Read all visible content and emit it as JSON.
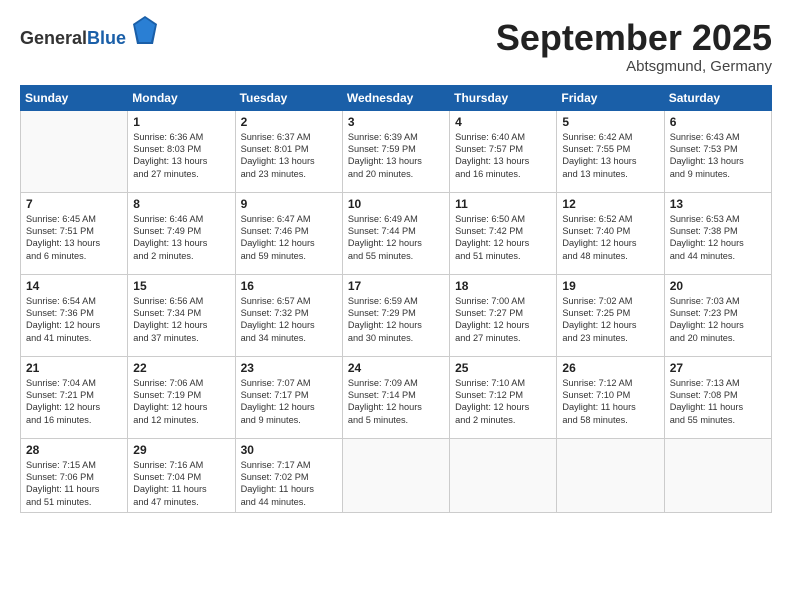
{
  "logo": {
    "general": "General",
    "blue": "Blue"
  },
  "header": {
    "month": "September 2025",
    "location": "Abtsgmund, Germany"
  },
  "weekdays": [
    "Sunday",
    "Monday",
    "Tuesday",
    "Wednesday",
    "Thursday",
    "Friday",
    "Saturday"
  ],
  "weeks": [
    [
      {
        "day": null,
        "data": null
      },
      {
        "day": "1",
        "data": "Sunrise: 6:36 AM\nSunset: 8:03 PM\nDaylight: 13 hours\nand 27 minutes."
      },
      {
        "day": "2",
        "data": "Sunrise: 6:37 AM\nSunset: 8:01 PM\nDaylight: 13 hours\nand 23 minutes."
      },
      {
        "day": "3",
        "data": "Sunrise: 6:39 AM\nSunset: 7:59 PM\nDaylight: 13 hours\nand 20 minutes."
      },
      {
        "day": "4",
        "data": "Sunrise: 6:40 AM\nSunset: 7:57 PM\nDaylight: 13 hours\nand 16 minutes."
      },
      {
        "day": "5",
        "data": "Sunrise: 6:42 AM\nSunset: 7:55 PM\nDaylight: 13 hours\nand 13 minutes."
      },
      {
        "day": "6",
        "data": "Sunrise: 6:43 AM\nSunset: 7:53 PM\nDaylight: 13 hours\nand 9 minutes."
      }
    ],
    [
      {
        "day": "7",
        "data": "Sunrise: 6:45 AM\nSunset: 7:51 PM\nDaylight: 13 hours\nand 6 minutes."
      },
      {
        "day": "8",
        "data": "Sunrise: 6:46 AM\nSunset: 7:49 PM\nDaylight: 13 hours\nand 2 minutes."
      },
      {
        "day": "9",
        "data": "Sunrise: 6:47 AM\nSunset: 7:46 PM\nDaylight: 12 hours\nand 59 minutes."
      },
      {
        "day": "10",
        "data": "Sunrise: 6:49 AM\nSunset: 7:44 PM\nDaylight: 12 hours\nand 55 minutes."
      },
      {
        "day": "11",
        "data": "Sunrise: 6:50 AM\nSunset: 7:42 PM\nDaylight: 12 hours\nand 51 minutes."
      },
      {
        "day": "12",
        "data": "Sunrise: 6:52 AM\nSunset: 7:40 PM\nDaylight: 12 hours\nand 48 minutes."
      },
      {
        "day": "13",
        "data": "Sunrise: 6:53 AM\nSunset: 7:38 PM\nDaylight: 12 hours\nand 44 minutes."
      }
    ],
    [
      {
        "day": "14",
        "data": "Sunrise: 6:54 AM\nSunset: 7:36 PM\nDaylight: 12 hours\nand 41 minutes."
      },
      {
        "day": "15",
        "data": "Sunrise: 6:56 AM\nSunset: 7:34 PM\nDaylight: 12 hours\nand 37 minutes."
      },
      {
        "day": "16",
        "data": "Sunrise: 6:57 AM\nSunset: 7:32 PM\nDaylight: 12 hours\nand 34 minutes."
      },
      {
        "day": "17",
        "data": "Sunrise: 6:59 AM\nSunset: 7:29 PM\nDaylight: 12 hours\nand 30 minutes."
      },
      {
        "day": "18",
        "data": "Sunrise: 7:00 AM\nSunset: 7:27 PM\nDaylight: 12 hours\nand 27 minutes."
      },
      {
        "day": "19",
        "data": "Sunrise: 7:02 AM\nSunset: 7:25 PM\nDaylight: 12 hours\nand 23 minutes."
      },
      {
        "day": "20",
        "data": "Sunrise: 7:03 AM\nSunset: 7:23 PM\nDaylight: 12 hours\nand 20 minutes."
      }
    ],
    [
      {
        "day": "21",
        "data": "Sunrise: 7:04 AM\nSunset: 7:21 PM\nDaylight: 12 hours\nand 16 minutes."
      },
      {
        "day": "22",
        "data": "Sunrise: 7:06 AM\nSunset: 7:19 PM\nDaylight: 12 hours\nand 12 minutes."
      },
      {
        "day": "23",
        "data": "Sunrise: 7:07 AM\nSunset: 7:17 PM\nDaylight: 12 hours\nand 9 minutes."
      },
      {
        "day": "24",
        "data": "Sunrise: 7:09 AM\nSunset: 7:14 PM\nDaylight: 12 hours\nand 5 minutes."
      },
      {
        "day": "25",
        "data": "Sunrise: 7:10 AM\nSunset: 7:12 PM\nDaylight: 12 hours\nand 2 minutes."
      },
      {
        "day": "26",
        "data": "Sunrise: 7:12 AM\nSunset: 7:10 PM\nDaylight: 11 hours\nand 58 minutes."
      },
      {
        "day": "27",
        "data": "Sunrise: 7:13 AM\nSunset: 7:08 PM\nDaylight: 11 hours\nand 55 minutes."
      }
    ],
    [
      {
        "day": "28",
        "data": "Sunrise: 7:15 AM\nSunset: 7:06 PM\nDaylight: 11 hours\nand 51 minutes."
      },
      {
        "day": "29",
        "data": "Sunrise: 7:16 AM\nSunset: 7:04 PM\nDaylight: 11 hours\nand 47 minutes."
      },
      {
        "day": "30",
        "data": "Sunrise: 7:17 AM\nSunset: 7:02 PM\nDaylight: 11 hours\nand 44 minutes."
      },
      {
        "day": null,
        "data": null
      },
      {
        "day": null,
        "data": null
      },
      {
        "day": null,
        "data": null
      },
      {
        "day": null,
        "data": null
      }
    ]
  ]
}
